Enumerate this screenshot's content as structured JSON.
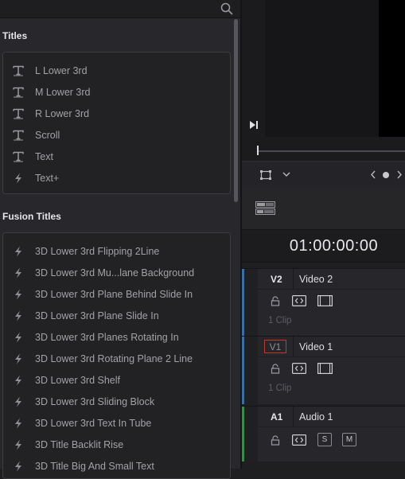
{
  "effects": {
    "search_icon": "search-icon",
    "titles": {
      "heading": "Titles",
      "items": [
        {
          "label": "L Lower 3rd",
          "icon": "text-t-icon"
        },
        {
          "label": "M Lower 3rd",
          "icon": "text-t-icon"
        },
        {
          "label": "R Lower 3rd",
          "icon": "text-t-icon"
        },
        {
          "label": "Scroll",
          "icon": "text-t-icon"
        },
        {
          "label": "Text",
          "icon": "text-t-icon"
        },
        {
          "label": "Text+",
          "icon": "fusion-bolt-icon"
        }
      ]
    },
    "fusion_titles": {
      "heading": "Fusion Titles",
      "items": [
        {
          "label": "3D Lower 3rd Flipping 2Line",
          "icon": "fusion-bolt-icon"
        },
        {
          "label": "3D Lower 3rd Mu...lane Background",
          "icon": "fusion-bolt-icon"
        },
        {
          "label": "3D Lower 3rd Plane Behind Slide In",
          "icon": "fusion-bolt-icon"
        },
        {
          "label": "3D Lower 3rd Plane Slide In",
          "icon": "fusion-bolt-icon"
        },
        {
          "label": "3D Lower 3rd Planes Rotating In",
          "icon": "fusion-bolt-icon"
        },
        {
          "label": "3D Lower 3rd Rotating Plane 2 Line",
          "icon": "fusion-bolt-icon"
        },
        {
          "label": "3D Lower 3rd Shelf",
          "icon": "fusion-bolt-icon"
        },
        {
          "label": "3D Lower 3rd Sliding Block",
          "icon": "fusion-bolt-icon"
        },
        {
          "label": "3D Lower 3rd Text In Tube",
          "icon": "fusion-bolt-icon"
        },
        {
          "label": "3D Title Backlit Rise",
          "icon": "fusion-bolt-icon"
        },
        {
          "label": "3D Title Big And Small Text",
          "icon": "fusion-bolt-icon"
        }
      ]
    }
  },
  "timeline": {
    "timecode": "01:00:00:00",
    "tracks": [
      {
        "id": "V2",
        "name": "Video 2",
        "clips": "1 Clip",
        "color": "#3a6ea5"
      },
      {
        "id": "V1",
        "name": "Video 1",
        "clips": "1 Clip",
        "color": "#3a6ea5"
      },
      {
        "id": "A1",
        "name": "Audio 1",
        "solo": "S",
        "mute": "M",
        "color": "#3b8a4e"
      }
    ]
  }
}
